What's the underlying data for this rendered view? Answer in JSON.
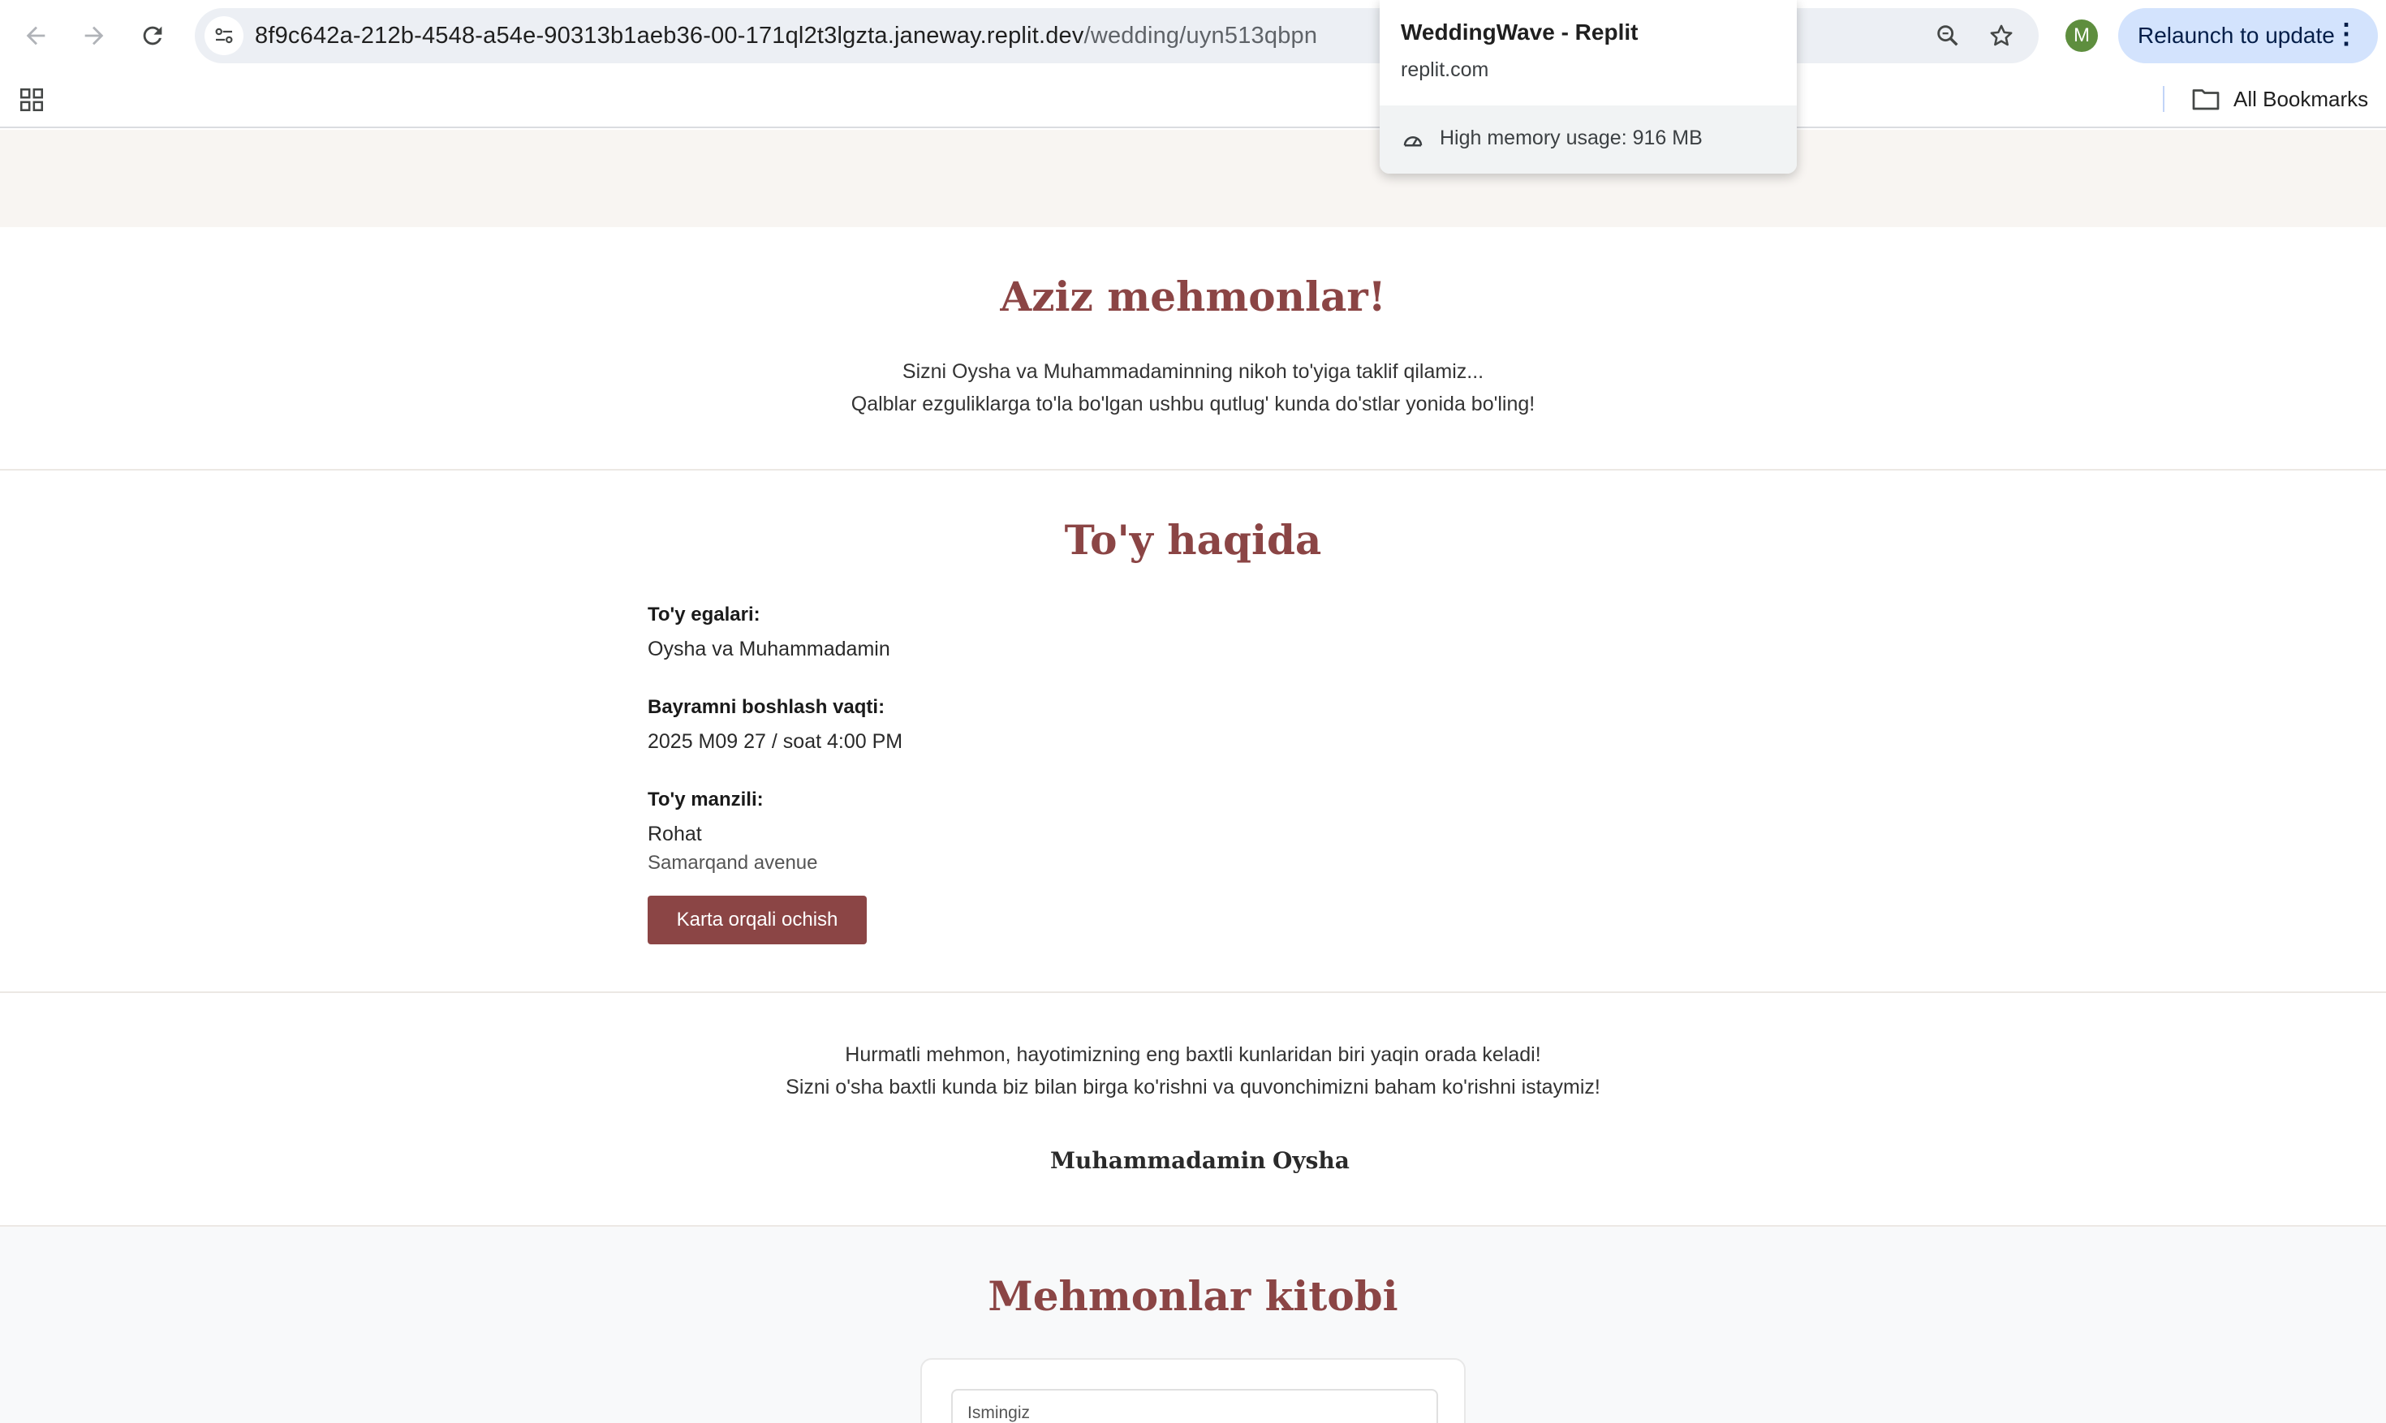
{
  "browser": {
    "url_host": "8f9c642a-212b-4548-a54e-90313b1aeb36-00-171ql2t3lgzta.janeway.replit.dev",
    "url_path": "/wedding/uyn513qbpn",
    "avatar_letter": "M",
    "relaunch_label": "Relaunch to update",
    "all_bookmarks_label": "All Bookmarks",
    "icons": [
      "back-arrow-icon",
      "forward-arrow-icon",
      "reload-icon",
      "site-info-icon",
      "zoom-icon",
      "star-icon",
      "apps-grid-icon",
      "folder-icon",
      "more-vert-icon",
      "memory-gauge-icon"
    ]
  },
  "hover_card": {
    "title": "WeddingWave - Replit",
    "domain": "replit.com",
    "memory_text": "High memory usage: 916 MB"
  },
  "welcome": {
    "title": "Aziz mehmonlar!",
    "line1": "Sizni Oysha va Muhammadaminning nikoh to'yiga taklif qilamiz...",
    "line2": "Qalblar ezguliklarga to'la bo'lgan ushbu qutlug' kunda do'stlar yonida bo'ling!"
  },
  "about": {
    "title": "To'y haqida",
    "hosts_label": "To'y egalari:",
    "hosts_value": "Oysha va Muhammadamin",
    "start_label": "Bayramni boshlash vaqti:",
    "start_value": "2025 M09 27 / soat 4:00 PM",
    "venue_label": "To'y manzili:",
    "venue_name": "Rohat",
    "venue_address": "Samarqand avenue",
    "map_button": "Karta orqali ochish"
  },
  "greeting": {
    "line1": "Hurmatli mehmon, hayotimizning eng baxtli kunlaridan biri yaqin orada keladi!",
    "line2": "Sizni o'sha baxtli kunda biz bilan birga ko'rishni va quvonchimizni baham ko'rishni istaymiz!",
    "name1": "Muhammadamin",
    "name2": "Oysha"
  },
  "guestbook": {
    "title": "Mehmonlar kitobi",
    "name_field_label": "Ismingiz"
  },
  "colors": {
    "accent": "#8b4545",
    "hero_band": "#f8f5f2",
    "guestbook_bg": "#f8f9fa",
    "relaunch_bg": "#d3e3fd"
  }
}
